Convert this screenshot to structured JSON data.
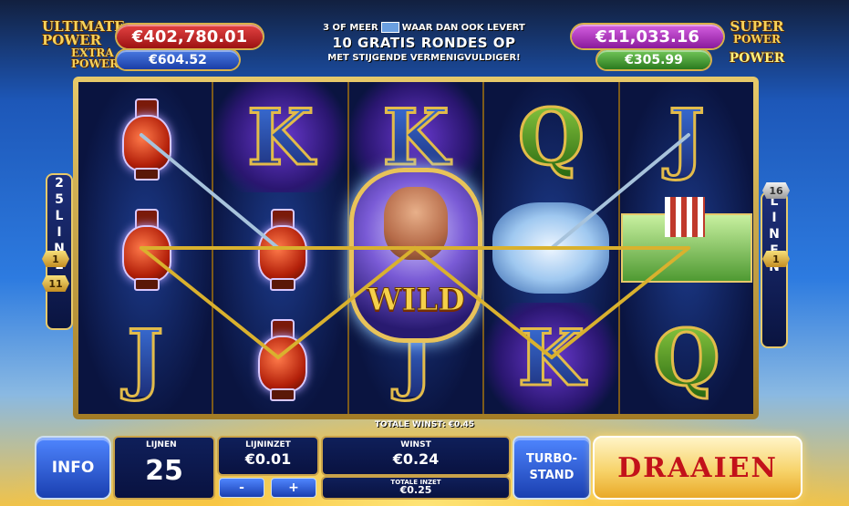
{
  "jackpots": {
    "left_title": [
      "ULTIMATE",
      "POWER",
      "EXTRA",
      "POWER"
    ],
    "ultimate_value": "€402,780.01",
    "extra_value": "€604.52",
    "right_title": [
      "SUPER",
      "POWER",
      "POWER"
    ],
    "super_value": "€11,033.16",
    "power_value": "€305.99"
  },
  "promo": {
    "line1_a": "3 OF MEER",
    "line1_b": "WAAR DAN OOK LEVERT",
    "line2": "10 GRATIS RONDES OP",
    "line3": "MET STIJGENDE VERMENIGVULDIGER!"
  },
  "reels": {
    "reel1": [
      "vase",
      "vase",
      "J"
    ],
    "reel2": [
      "K",
      "vase",
      "vase"
    ],
    "reel3": [
      "K",
      "WILD",
      "J"
    ],
    "reel4": [
      "Q",
      "pegasus",
      "K"
    ],
    "reel5": [
      "J",
      "ship",
      "Q"
    ],
    "wild_label": "WILD"
  },
  "side_left": {
    "text": [
      "2",
      "5",
      "L",
      "I",
      "N",
      "E",
      "N"
    ]
  },
  "side_right": {
    "text": [
      "L",
      "I",
      "N",
      "E",
      "N"
    ]
  },
  "markers": {
    "left_top": "1",
    "left_bottom": "11",
    "right_top": "16",
    "right_mid": "1"
  },
  "bottom": {
    "totale_winst_label": "TOTALE WINST:",
    "totale_winst_value": "€0.45",
    "info_label": "INFO",
    "lijnen_label": "LIJNEN",
    "lijnen_value": "25",
    "lijninzet_label": "LIJNINZET",
    "lijninzet_value": "€0.01",
    "minus_label": "-",
    "plus_label": "+",
    "winst_label": "WINST",
    "winst_value": "€0.24",
    "totale_inzet_label": "TOTALE INZET",
    "totale_inzet_value": "€0.25",
    "turbo_line1": "TURBO-",
    "turbo_line2": "STAND",
    "spin_label": "DRAAIEN"
  },
  "colors": {
    "payline_blue": "#a7c3dc",
    "payline_gold": "#d9b12e",
    "spin_text": "#c2121a"
  }
}
